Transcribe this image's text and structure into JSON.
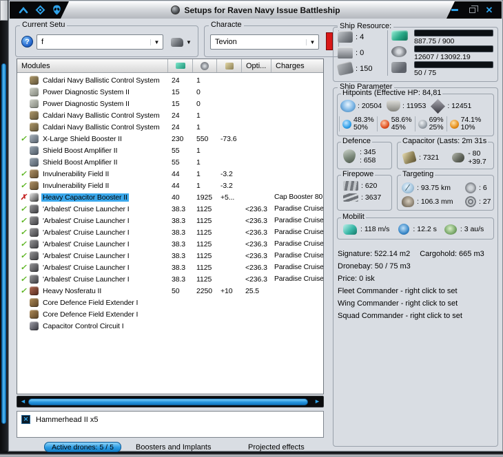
{
  "colors": {
    "accent": "#2fa3ea",
    "sel": "#3aa8ec",
    "check": "#5ab41e",
    "cross": "#c41e1e",
    "flag": "#d81818"
  },
  "window": {
    "title": "Setups for Raven Navy Issue Battleship"
  },
  "setup": {
    "group_label": "Current Setu",
    "help": "?",
    "value": "f"
  },
  "character": {
    "group_label": "Characte",
    "value": "Tevion"
  },
  "ship_resources": {
    "group_label": "Ship Resource:",
    "hardpoints": [
      {
        "icon": "turret-hardpoints-icon",
        "value": ": 4"
      },
      {
        "icon": "launcher-hardpoints-icon",
        "value": ": 0"
      },
      {
        "icon": "rig-slots-icon",
        "value": ": 150"
      }
    ],
    "bars": [
      {
        "icon": "cpu-icon",
        "text": "887.75 / 900",
        "pct": 98.6
      },
      {
        "icon": "powergrid-icon",
        "text": "12607 / 13092.19",
        "pct": 96.3
      },
      {
        "icon": "calibration-icon",
        "text": "50 / 75",
        "pct": 66.7
      }
    ]
  },
  "modules_table": {
    "header": {
      "modules": "Modules",
      "opti": "Opti...",
      "charges": "Charges"
    },
    "rows": [
      {
        "icon": "ballistic-control",
        "name": "Caldari Navy Ballistic Control System",
        "cpu": "24",
        "pg": "1"
      },
      {
        "icon": "power-diagnostic",
        "name": "Power Diagnostic System II",
        "cpu": "15",
        "pg": "0"
      },
      {
        "icon": "power-diagnostic",
        "name": "Power Diagnostic System II",
        "cpu": "15",
        "pg": "0"
      },
      {
        "icon": "ballistic-control",
        "name": "Caldari Navy Ballistic Control System",
        "cpu": "24",
        "pg": "1"
      },
      {
        "icon": "ballistic-control",
        "name": "Caldari Navy Ballistic Control System",
        "cpu": "24",
        "pg": "1"
      },
      {
        "status": "check",
        "icon": "shield-booster",
        "name": "X-Large Shield Booster II",
        "cpu": "230",
        "pg": "550",
        "cap": "-73.6"
      },
      {
        "icon": "shield-amplifier",
        "name": "Shield Boost Amplifier II",
        "cpu": "55",
        "pg": "1"
      },
      {
        "icon": "shield-amplifier",
        "name": "Shield Boost Amplifier II",
        "cpu": "55",
        "pg": "1"
      },
      {
        "status": "check",
        "icon": "invulnerability-field",
        "name": "Invulnerability Field II",
        "cpu": "44",
        "pg": "1",
        "cap": "-3.2"
      },
      {
        "status": "check",
        "icon": "invulnerability-field",
        "name": "Invulnerability Field II",
        "cpu": "44",
        "pg": "1",
        "cap": "-3.2"
      },
      {
        "status": "x",
        "icon": "capacitor-booster",
        "name": "Heavy Capacitor Booster II",
        "state": "selected",
        "cpu": "40",
        "pg": "1925",
        "cap": "+5...",
        "charges": "Cap Booster 80"
      },
      {
        "status": "check",
        "icon": "cruise-launcher",
        "name": "'Arbalest' Cruise Launcher I",
        "cpu": "38.3",
        "pg": "1125",
        "opti": "<236.3",
        "charges": "Paradise Cruise"
      },
      {
        "status": "check",
        "icon": "cruise-launcher",
        "name": "'Arbalest' Cruise Launcher I",
        "cpu": "38.3",
        "pg": "1125",
        "opti": "<236.3",
        "charges": "Paradise Cruise"
      },
      {
        "status": "check",
        "icon": "cruise-launcher",
        "name": "'Arbalest' Cruise Launcher I",
        "cpu": "38.3",
        "pg": "1125",
        "opti": "<236.3",
        "charges": "Paradise Cruise"
      },
      {
        "status": "check",
        "icon": "cruise-launcher",
        "name": "'Arbalest' Cruise Launcher I",
        "cpu": "38.3",
        "pg": "1125",
        "opti": "<236.3",
        "charges": "Paradise Cruise"
      },
      {
        "status": "check",
        "icon": "cruise-launcher",
        "name": "'Arbalest' Cruise Launcher I",
        "cpu": "38.3",
        "pg": "1125",
        "opti": "<236.3",
        "charges": "Paradise Cruise"
      },
      {
        "status": "check",
        "icon": "cruise-launcher",
        "name": "'Arbalest' Cruise Launcher I",
        "cpu": "38.3",
        "pg": "1125",
        "opti": "<236.3",
        "charges": "Paradise Cruise"
      },
      {
        "status": "check",
        "icon": "cruise-launcher",
        "name": "'Arbalest' Cruise Launcher I",
        "cpu": "38.3",
        "pg": "1125",
        "opti": "<236.3",
        "charges": "Paradise Cruise"
      },
      {
        "status": "check",
        "icon": "nosferatu",
        "name": "Heavy Nosferatu II",
        "cpu": "50",
        "pg": "2250",
        "cap": "+10",
        "opti": "25.5"
      },
      {
        "icon": "rig-shield",
        "name": "Core Defence Field Extender I"
      },
      {
        "icon": "rig-shield",
        "name": "Core Defence Field Extender I"
      },
      {
        "icon": "rig-capacitor",
        "name": "Capacitor Control Circuit I"
      }
    ]
  },
  "scrollbar": {
    "left": "◄",
    "right": "►"
  },
  "drones": {
    "items": [
      {
        "icon": "x",
        "label": "Hammerhead II x5"
      }
    ]
  },
  "tabs": {
    "active_drones": "Active drones: 5 / 5",
    "boosters": "Boosters and Implants",
    "projected": "Projected effects"
  },
  "ship_parameters": {
    "group_label": "Ship Parameter",
    "hitpoints": {
      "label": "Hitpoints (Effective HP: 84,81",
      "shield": ": 20504",
      "armor": ": 11953",
      "structure": ": 12451",
      "resists": [
        {
          "icon": "em-icon",
          "shield": "48.3%",
          "armor": "50%"
        },
        {
          "icon": "thermal-icon",
          "shield": "58.6%",
          "armor": "45%"
        },
        {
          "icon": "kinetic-icon",
          "shield": "69%",
          "armor": "25%"
        },
        {
          "icon": "explosive-icon",
          "shield": "74.1%",
          "armor": "10%"
        }
      ]
    },
    "defence": {
      "label": "Defence",
      "value1": ": 345",
      "value2": ": 658"
    },
    "capacitor": {
      "label": "Capacitor (Lasts: 2m 31s",
      "amount": ": 7321",
      "delta1": "- 80",
      "delta2": "+39.7"
    },
    "firepower": {
      "label": "Firepowe",
      "turret": ": 620",
      "missile": ": 3637"
    },
    "targeting": {
      "label": "Targeting",
      "range": ": 93.75 km",
      "max_targets": ": 6",
      "scan_res": ": 106.3 mm",
      "sig_res": ": 27"
    },
    "mobility": {
      "label": "Mobilit",
      "speed": ": 118 m/s",
      "align": ": 12.2 s",
      "warp": ": 3 au/s"
    },
    "info": {
      "signature": "Signature: 522.14 m2",
      "cargohold": "Cargohold: 665 m3",
      "dronebay": "Dronebay: 50 / 75 m3",
      "price": "Price: 0 isk",
      "fleet": "Fleet Commander - right click to set",
      "wing": "Wing Commander - right click to set",
      "squad": "Squad Commander - right click to set"
    }
  }
}
